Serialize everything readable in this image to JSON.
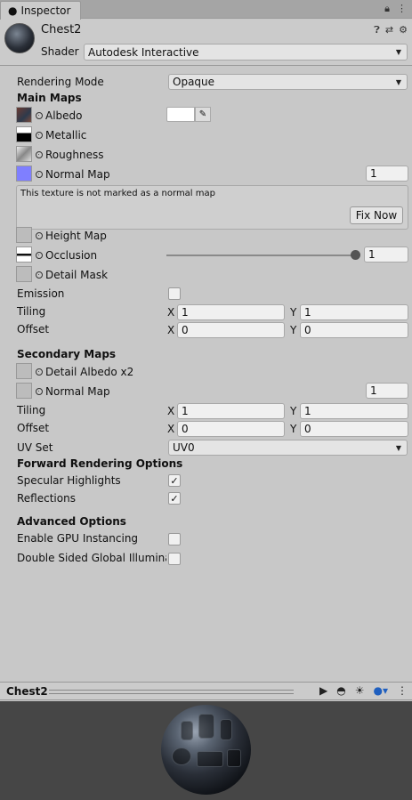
{
  "tab": {
    "title": "Inspector",
    "lock_icon": "lock-icon",
    "menu_icon": "kebab-menu-icon"
  },
  "header": {
    "material_name": "Chest2",
    "shader_label": "Shader",
    "shader_value": "Autodesk Interactive",
    "icons": [
      "help-icon",
      "preset-icon",
      "settings-icon"
    ]
  },
  "rendering_mode": {
    "label": "Rendering Mode",
    "value": "Opaque"
  },
  "main_maps": {
    "title": "Main Maps",
    "albedo": "Albedo",
    "metallic": "Metallic",
    "roughness": "Roughness",
    "normal_map": "Normal Map",
    "normal_value": "1",
    "warning": "This texture is not marked as a normal map",
    "fix_button": "Fix Now",
    "height_map": "Height Map",
    "occlusion": "Occlusion",
    "occlusion_value": "1",
    "occlusion_level": 1.0,
    "detail_mask": "Detail Mask",
    "emission": "Emission",
    "tiling_label": "Tiling",
    "offset_label": "Offset",
    "x_label": "X",
    "y_label": "Y",
    "tiling_x": "1",
    "tiling_y": "1",
    "offset_x": "0",
    "offset_y": "0"
  },
  "secondary_maps": {
    "title": "Secondary Maps",
    "detail_albedo": "Detail Albedo x2",
    "normal_map": "Normal Map",
    "normal_value": "1",
    "tiling_label": "Tiling",
    "offset_label": "Offset",
    "tiling_x": "1",
    "tiling_y": "1",
    "offset_x": "0",
    "offset_y": "0",
    "uv_set_label": "UV Set",
    "uv_set_value": "UV0"
  },
  "forward_rendering": {
    "title": "Forward Rendering Options",
    "specular_label": "Specular Highlights",
    "specular_checked": true,
    "reflections_label": "Reflections",
    "reflections_checked": true,
    "check_glyph": "✓"
  },
  "advanced": {
    "title": "Advanced Options",
    "gpu_label": "Enable GPU Instancing",
    "gpu_checked": false,
    "gi_label": "Double Sided Global Illuminati",
    "gi_checked": false
  },
  "preview": {
    "title": "Chest2"
  },
  "colors": {
    "normal_slot": "#7f7fff",
    "albedo_swatch": "#ffffff"
  }
}
